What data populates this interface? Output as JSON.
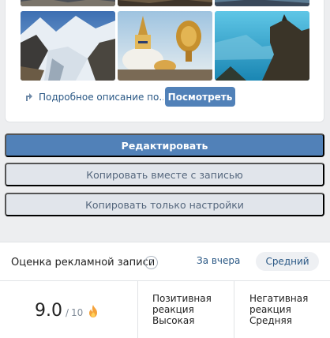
{
  "gallery": {
    "images": [
      {
        "name": "image-top-1"
      },
      {
        "name": "image-top-2"
      },
      {
        "name": "image-top-3"
      },
      {
        "name": "image-glacier"
      },
      {
        "name": "image-stupa"
      },
      {
        "name": "image-cliff"
      }
    ],
    "detail_link": "Подробное описание по...",
    "view_button": "Посмотреть"
  },
  "actions": {
    "edit": "Редактировать",
    "copy_with_post": "Копировать вместе с записью",
    "copy_settings_only": "Копировать только настройки"
  },
  "rating": {
    "title": "Оценка рекламной записи",
    "help": "?",
    "period": "За вчера",
    "level": "Средний",
    "score": "9.0",
    "score_separator": "/",
    "score_max": "10",
    "positive": {
      "label_line1": "Позитивная",
      "label_line2": "реакция",
      "value": "Высокая"
    },
    "negative": {
      "label_line1": "Негативная",
      "label_line2": "реакция",
      "value": "Средняя"
    }
  },
  "colors": {
    "accent": "#5181b8",
    "link": "#2a5885",
    "secondary_button": "#e1e5eb"
  }
}
